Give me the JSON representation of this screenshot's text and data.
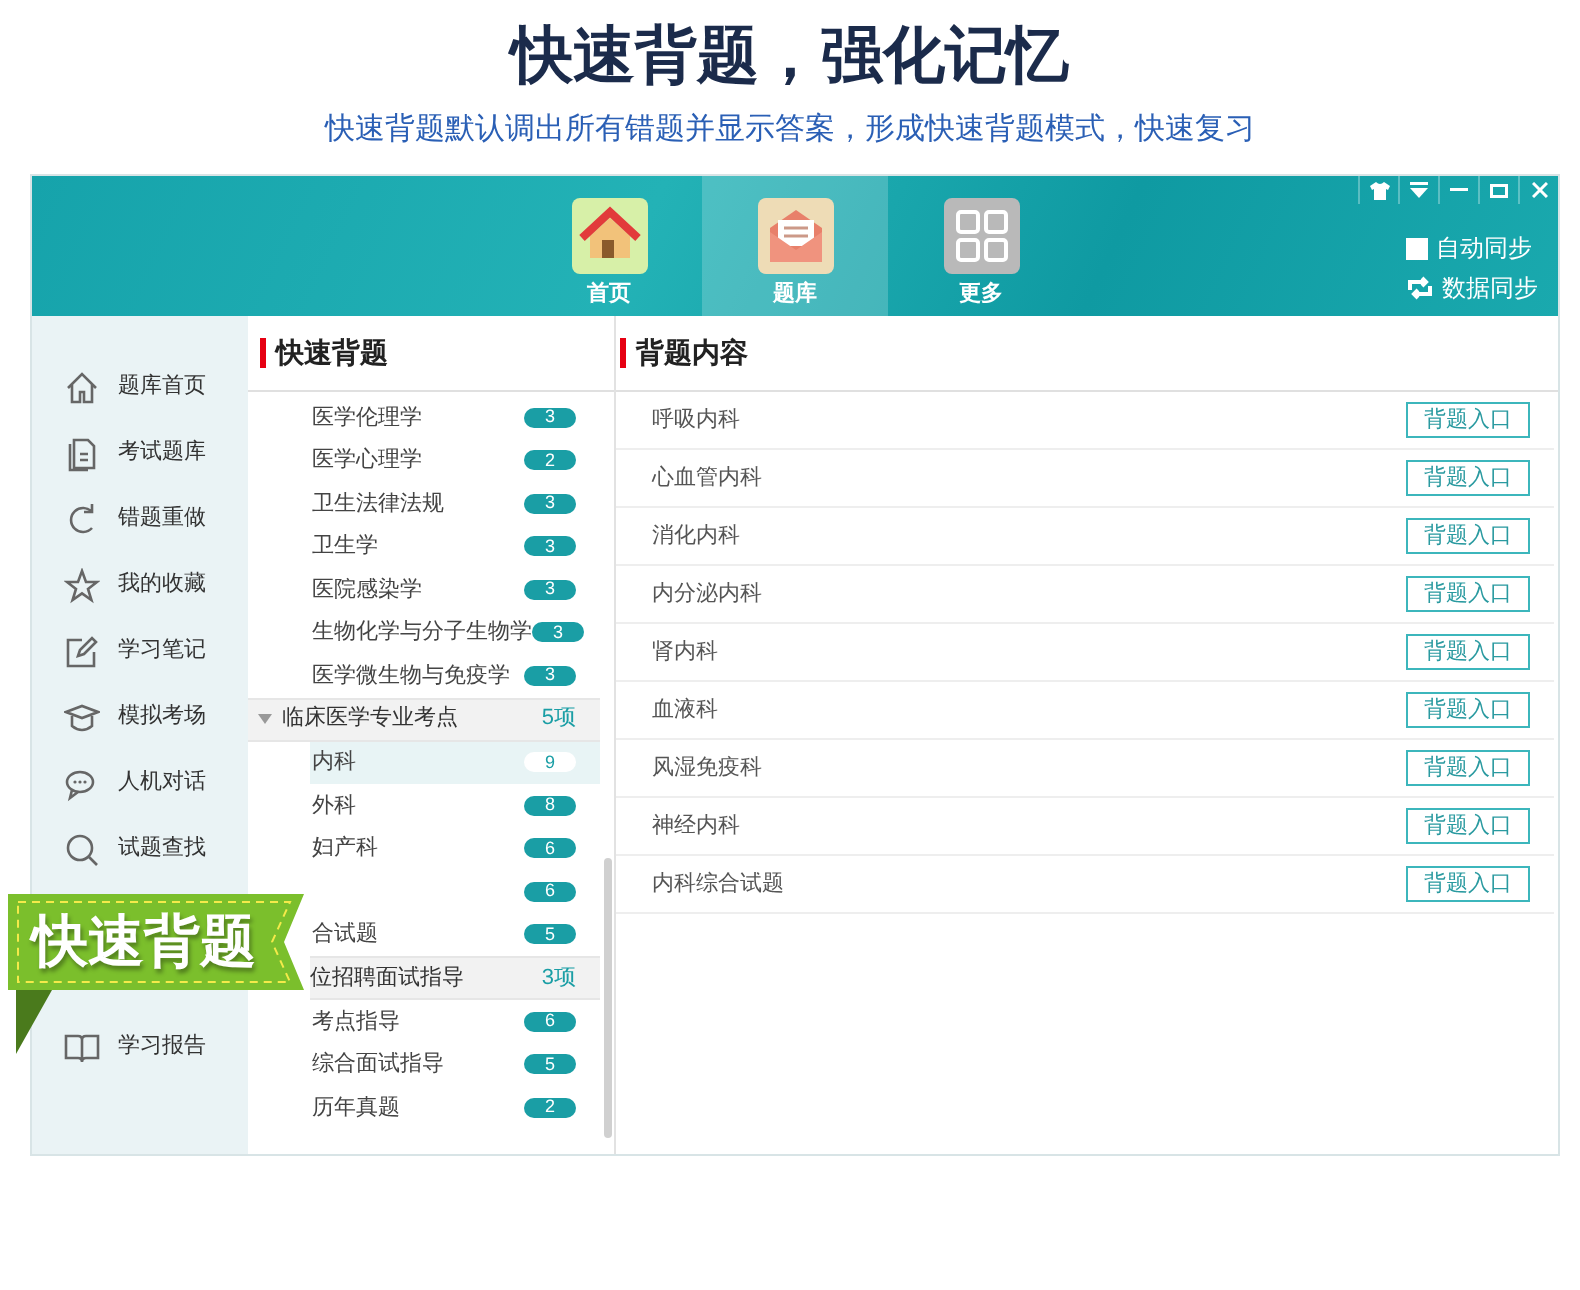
{
  "banner": {
    "title": "快速背题，强化记忆",
    "subtitle": "快速背题默认调出所有错题并显示答案，形成快速背题模式，快速复习"
  },
  "top_nav": [
    {
      "label": "首页",
      "selected": false
    },
    {
      "label": "题库",
      "selected": true
    },
    {
      "label": "更多",
      "selected": false
    }
  ],
  "sync": {
    "auto_sync": {
      "label": "自动同步",
      "checked": false
    },
    "data_sync": {
      "label": "数据同步"
    }
  },
  "sidebar": {
    "items": [
      {
        "label": "题库首页"
      },
      {
        "label": "考试题库"
      },
      {
        "label": "错题重做"
      },
      {
        "label": "我的收藏"
      },
      {
        "label": "学习笔记"
      },
      {
        "label": "模拟考场"
      },
      {
        "label": "人机对话"
      },
      {
        "label": "试题查找"
      },
      {
        "label": "学习报告"
      }
    ]
  },
  "middle_panel": {
    "title": "快速背题",
    "items": [
      {
        "kind": "item",
        "label": "医学伦理学",
        "count": "3",
        "selected": false
      },
      {
        "kind": "item",
        "label": "医学心理学",
        "count": "2",
        "selected": false
      },
      {
        "kind": "item",
        "label": "卫生法律法规",
        "count": "3",
        "selected": false
      },
      {
        "kind": "item",
        "label": "卫生学",
        "count": "3",
        "selected": false
      },
      {
        "kind": "item",
        "label": "医院感染学",
        "count": "3",
        "selected": false
      },
      {
        "kind": "item",
        "label": "生物化学与分子生物学",
        "count": "3",
        "selected": false
      },
      {
        "kind": "item",
        "label": "医学微生物与免疫学",
        "count": "3",
        "selected": false
      },
      {
        "kind": "group",
        "label": "临床医学专业考点",
        "count": "5项",
        "expanded": true
      },
      {
        "kind": "item",
        "label": "内科",
        "count": "9",
        "selected": true
      },
      {
        "kind": "item",
        "label": "外科",
        "count": "8",
        "selected": false
      },
      {
        "kind": "item",
        "label": "妇产科",
        "count": "6",
        "selected": false
      },
      {
        "kind": "item",
        "count": "6",
        "selected": false
      },
      {
        "kind": "item",
        "label": "合试题",
        "count": "5",
        "selected": false
      },
      {
        "kind": "group",
        "label": "位招聘面试指导",
        "count": "3项"
      },
      {
        "kind": "item",
        "label": "考点指导",
        "count": "6",
        "selected": false
      },
      {
        "kind": "item",
        "label": "综合面试指导",
        "count": "5",
        "selected": false
      },
      {
        "kind": "item",
        "label": "历年真题",
        "count": "2",
        "selected": false
      }
    ]
  },
  "content_panel": {
    "title": "背题内容",
    "rows": [
      {
        "label": "呼吸内科",
        "button": "背题入口"
      },
      {
        "label": "心血管内科",
        "button": "背题入口"
      },
      {
        "label": "消化内科",
        "button": "背题入口"
      },
      {
        "label": "内分泌内科",
        "button": "背题入口"
      },
      {
        "label": "肾内科",
        "button": "背题入口"
      },
      {
        "label": "血液科",
        "button": "背题入口"
      },
      {
        "label": "风湿免疫科",
        "button": "背题入口"
      },
      {
        "label": "神经内科",
        "button": "背题入口"
      },
      {
        "label": "内科综合试题",
        "button": "背题入口"
      }
    ]
  },
  "ribbon": {
    "text": "快速背题"
  }
}
